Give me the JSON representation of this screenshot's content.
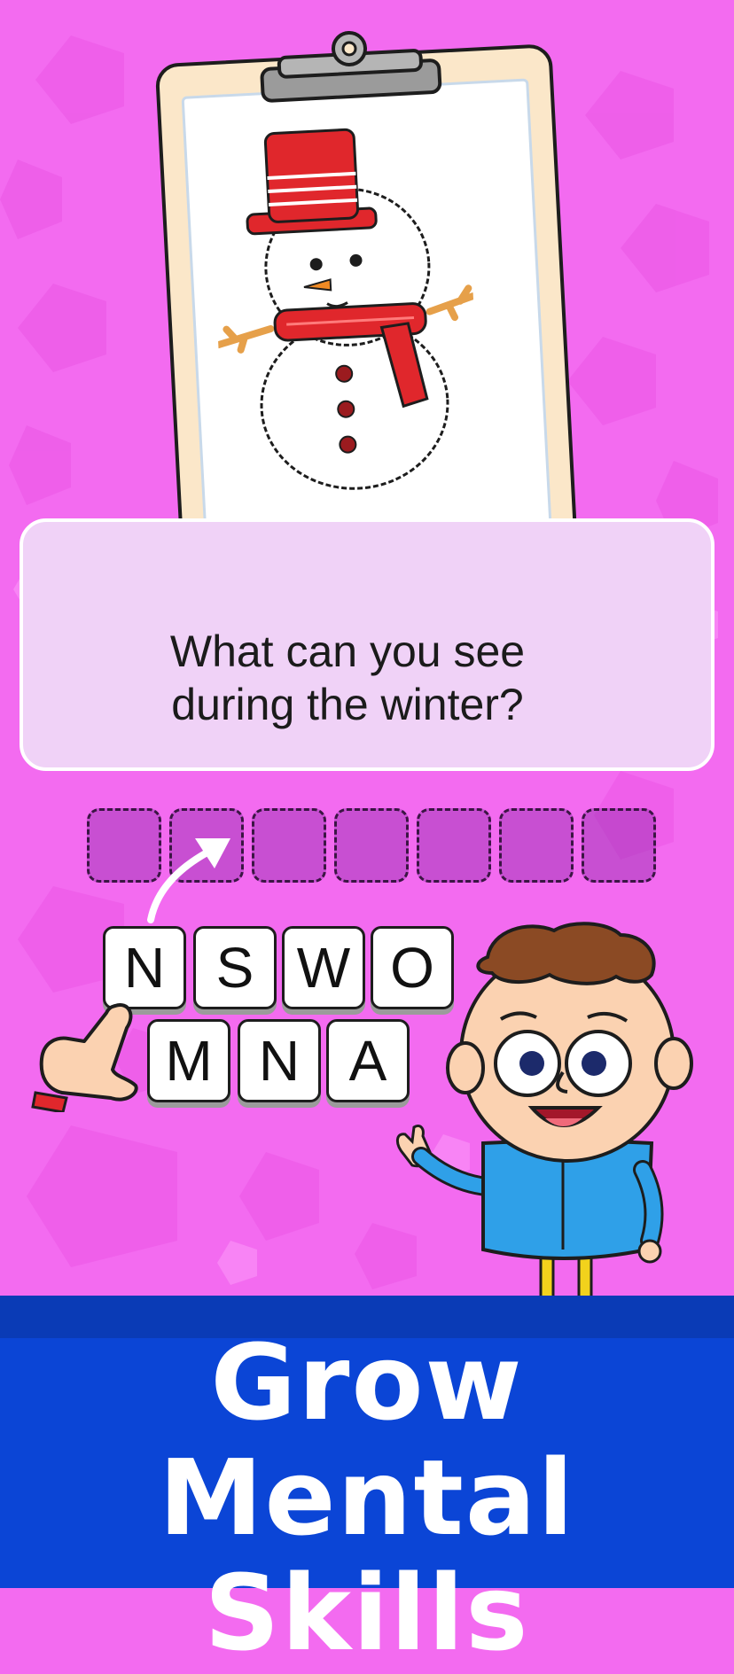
{
  "question": {
    "line1": "What can you see",
    "line2": "during the winter?"
  },
  "answer_slots": {
    "count": 7
  },
  "letter_tiles": {
    "row1": [
      "N",
      "S",
      "W",
      "O"
    ],
    "row2": [
      "M",
      "N",
      "A"
    ]
  },
  "headline": {
    "line1": "Grow Mental",
    "line2": "Skills"
  },
  "colors": {
    "background": "#f36bf0",
    "card": "#f0d2f7",
    "band": "#0b45d6",
    "headline_text": "#ffffff"
  },
  "icons": [
    "clipboard-icon",
    "snowman-illustration",
    "pointing-hand-icon",
    "arrow-icon",
    "kid-character"
  ]
}
